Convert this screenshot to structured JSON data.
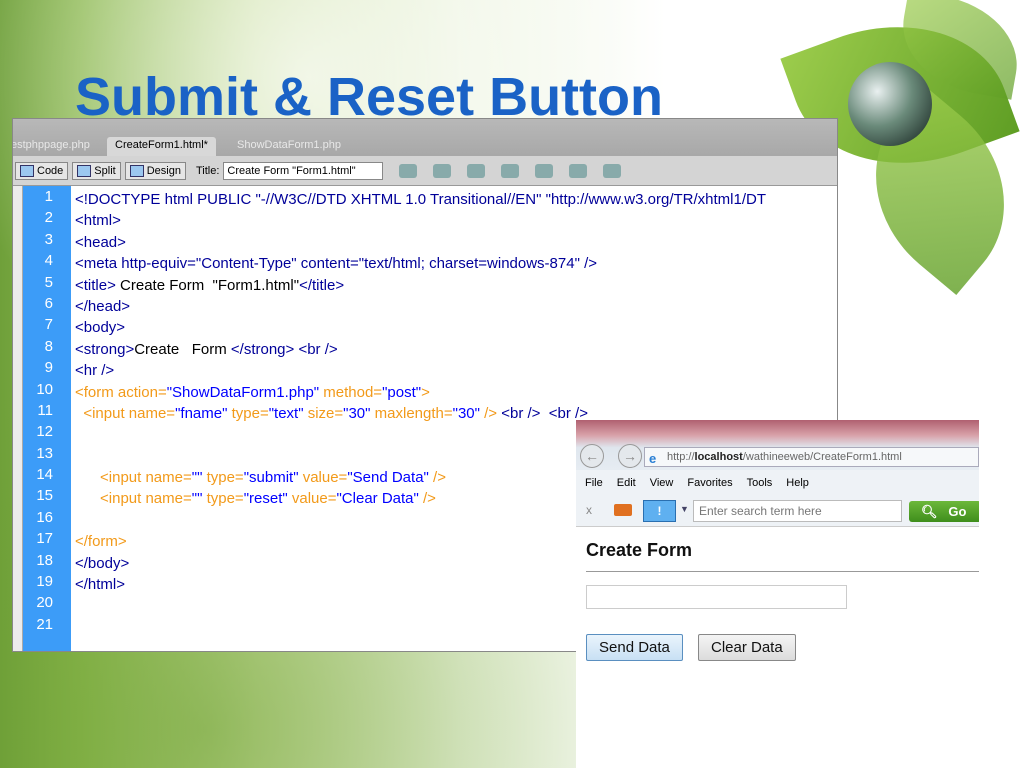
{
  "slide_title": "Submit & Reset Button",
  "editor": {
    "tabs": [
      "estphppage.php",
      "CreateForm1.html*",
      "ShowDataForm1.php"
    ],
    "view_buttons": [
      "Code",
      "Split",
      "Design"
    ],
    "title_label": "Title:",
    "title_value": "Create Form  \"Form1.html\"",
    "line_numbers": [
      "1",
      "2",
      "3",
      "4",
      "5",
      "6",
      "7",
      "8",
      "9",
      "10",
      "11",
      "12",
      "13",
      "14",
      "15",
      "16",
      "17",
      "18",
      "19",
      "20",
      "21"
    ],
    "lines": [
      [
        [
          "t",
          "<!DOCTYPE html PUBLIC \"-//W3C//DTD XHTML 1.0 Transitional//EN\" \"http://www.w3.org/TR/xhtml1/DT"
        ]
      ],
      [
        [
          "t",
          "<html>"
        ]
      ],
      [
        [
          "t",
          "<head>"
        ]
      ],
      [
        [
          "t",
          "<meta http-equiv=\"Content-Type\" content=\"text/html; charset=windows-874\" />"
        ]
      ],
      [
        [
          "t",
          "<title>"
        ],
        [
          "x",
          " Create Form  \"Form1.html\""
        ],
        [
          "t",
          "</title>"
        ]
      ],
      [
        [
          "t",
          "</head>"
        ]
      ],
      [
        [
          "t",
          "<body>"
        ]
      ],
      [
        [
          "t",
          "<strong>"
        ],
        [
          "x",
          "Create   Form "
        ],
        [
          "t",
          "</strong> <br />"
        ]
      ],
      [
        [
          "t",
          "<hr />"
        ]
      ],
      [
        [
          "o",
          "<form action="
        ],
        [
          "v",
          "\"ShowDataForm1.php\""
        ],
        [
          "o",
          " method="
        ],
        [
          "v",
          "\"post\""
        ],
        [
          "o",
          ">"
        ]
      ],
      [
        [
          "o",
          "  <input name="
        ],
        [
          "v",
          "\"fname\""
        ],
        [
          "o",
          " type="
        ],
        [
          "v",
          "\"text\""
        ],
        [
          "o",
          " size="
        ],
        [
          "v",
          "\"30\""
        ],
        [
          "o",
          " maxlength="
        ],
        [
          "v",
          "\"30\""
        ],
        [
          "o",
          " />"
        ],
        [
          "t",
          " <br />  <br />"
        ]
      ],
      [],
      [],
      [
        [
          "o",
          "      <input name="
        ],
        [
          "v",
          "\"\""
        ],
        [
          "o",
          " type="
        ],
        [
          "v",
          "\"submit\""
        ],
        [
          "o",
          " value="
        ],
        [
          "v",
          "\"Send Data\""
        ],
        [
          "o",
          " />"
        ]
      ],
      [
        [
          "o",
          "      <input name="
        ],
        [
          "v",
          "\"\""
        ],
        [
          "o",
          " type="
        ],
        [
          "v",
          "\"reset\""
        ],
        [
          "o",
          " value="
        ],
        [
          "v",
          "\"Clear Data\""
        ],
        [
          "o",
          " />"
        ]
      ],
      [],
      [
        [
          "o",
          "</form>"
        ]
      ],
      [
        [
          "t",
          "</body>"
        ]
      ],
      [
        [
          "t",
          "</html>"
        ]
      ],
      [],
      []
    ]
  },
  "browser": {
    "url_prefix": "http://",
    "url_host": "localhost",
    "url_path": "/wathineeweb/CreateForm1.html",
    "menu": [
      "File",
      "Edit",
      "View",
      "Favorites",
      "Tools",
      "Help"
    ],
    "search_placeholder": "Enter search term here",
    "go_label": "Go",
    "page_heading": "Create Form",
    "submit_label": "Send Data",
    "reset_label": "Clear Data"
  }
}
